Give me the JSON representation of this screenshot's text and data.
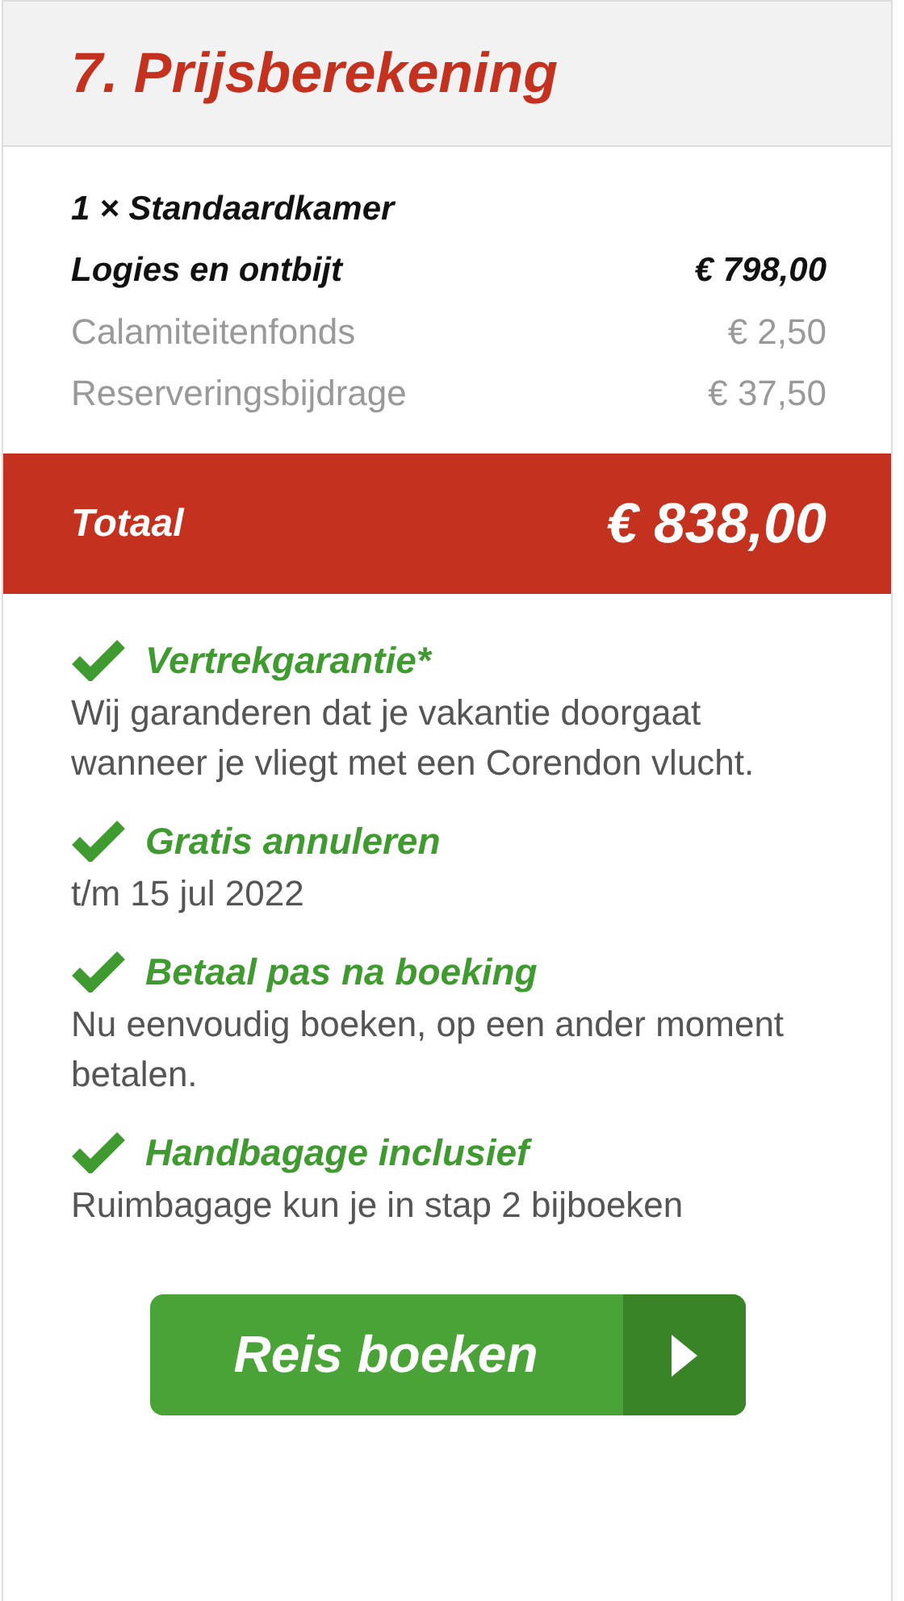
{
  "title": "7. Prijsberekening",
  "lines": [
    {
      "kind": "room",
      "label": "1 × Standaardkamer"
    },
    {
      "kind": "item",
      "label": "Logies en ontbijt",
      "amount": "€ 798,00"
    },
    {
      "kind": "fee",
      "label": "Calamiteitenfonds",
      "amount": "€ 2,50"
    },
    {
      "kind": "fee",
      "label": "Reserveringsbijdrage",
      "amount": "€ 37,50"
    }
  ],
  "total": {
    "label": "Totaal",
    "amount": "€ 838,00"
  },
  "features": [
    {
      "title": "Vertrekgarantie*",
      "text": "Wij garanderen dat je vakantie doorgaat wanneer je vliegt met een Corendon vlucht."
    },
    {
      "title": "Gratis annuleren",
      "text": "t/m 15 jul 2022"
    },
    {
      "title": "Betaal pas na boeking",
      "text": "Nu eenvoudig boeken, op een ander moment betalen."
    },
    {
      "title": "Handbagage inclusief",
      "text": "Ruimbagage kun je in stap 2 bijboeken"
    }
  ],
  "button": {
    "label": "Reis boeken"
  }
}
